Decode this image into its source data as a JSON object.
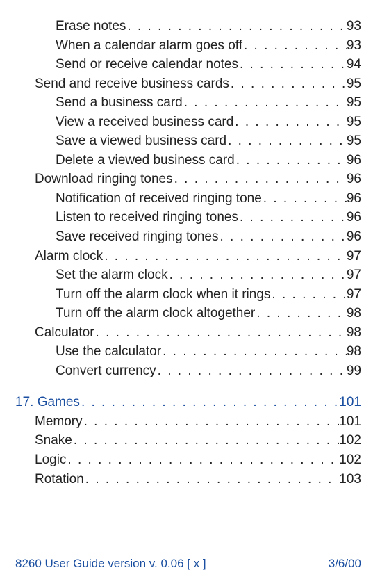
{
  "toc": {
    "entries": [
      {
        "level": 2,
        "label": "Erase notes",
        "page": "93"
      },
      {
        "level": 2,
        "label": "When a calendar alarm goes off",
        "page": "93"
      },
      {
        "level": 2,
        "label": "Send or receive calendar notes",
        "page": "94"
      },
      {
        "level": 1,
        "label": "Send and receive business cards",
        "page": "95"
      },
      {
        "level": 2,
        "label": "Send a business card",
        "page": "95"
      },
      {
        "level": 2,
        "label": "View a received business card",
        "page": "95"
      },
      {
        "level": 2,
        "label": "Save a viewed business card",
        "page": "95"
      },
      {
        "level": 2,
        "label": "Delete a viewed business card",
        "page": "96"
      },
      {
        "level": 1,
        "label": "Download ringing tones",
        "page": "96"
      },
      {
        "level": 2,
        "label": "Notification of received ringing tone",
        "page": "96"
      },
      {
        "level": 2,
        "label": "Listen to received ringing tones",
        "page": "96"
      },
      {
        "level": 2,
        "label": "Save received ringing tones",
        "page": "96"
      },
      {
        "level": 1,
        "label": "Alarm clock",
        "page": "97"
      },
      {
        "level": 2,
        "label": "Set the alarm clock",
        "page": "97"
      },
      {
        "level": 2,
        "label": "Turn off the alarm clock when it rings",
        "page": "97"
      },
      {
        "level": 2,
        "label": "Turn off the alarm clock altogether",
        "page": "98"
      },
      {
        "level": 1,
        "label": "Calculator",
        "page": "98"
      },
      {
        "level": 2,
        "label": "Use the calculator",
        "page": "98"
      },
      {
        "level": 2,
        "label": "Convert currency",
        "page": "99"
      },
      {
        "spacer": true
      },
      {
        "level": 0,
        "label": "17. Games",
        "page": "101",
        "chapter": true
      },
      {
        "level": 1,
        "label": "Memory",
        "page": "101"
      },
      {
        "level": 1,
        "label": "Snake",
        "page": "102"
      },
      {
        "level": 1,
        "label": "Logic",
        "page": "102"
      },
      {
        "level": 1,
        "label": "Rotation",
        "page": "103"
      }
    ]
  },
  "footer": {
    "left": "8260 User Guide version v. 0.06 [ x ]",
    "right": "3/6/00"
  }
}
